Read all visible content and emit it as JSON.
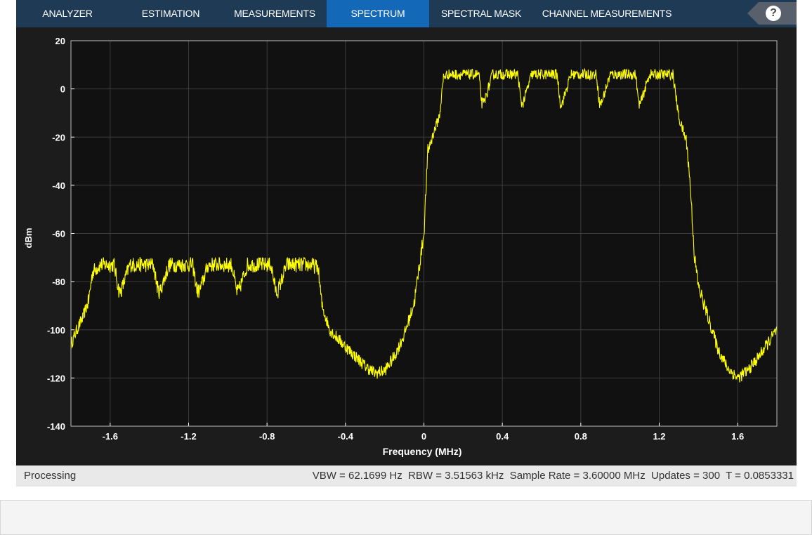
{
  "toolbar": {
    "tabs": [
      {
        "label": "ANALYZER",
        "active": false
      },
      {
        "label": "ESTIMATION",
        "active": false
      },
      {
        "label": "MEASUREMENTS",
        "active": false
      },
      {
        "label": "SPECTRUM",
        "active": true
      },
      {
        "label": "SPECTRAL MASK",
        "active": false
      },
      {
        "label": "CHANNEL MEASUREMENTS",
        "active": false
      }
    ],
    "help_label": "?"
  },
  "colors": {
    "toolbar_bg": "#1f3a54",
    "active_tab": "#1468b8",
    "plot_bg": "#111111",
    "trace": "#ffff00"
  },
  "status": {
    "left": "Processing",
    "right": "VBW = 62.1699 Hz  RBW = 3.51563 kHz  Sample Rate = 3.60000 MHz  Updates = 300  T = 0.0853331"
  },
  "chart_data": {
    "type": "line",
    "xlabel": "Frequency (MHz)",
    "ylabel": "dBm",
    "xlim": [
      -1.8,
      1.8
    ],
    "ylim": [
      -140,
      20
    ],
    "xticks": [
      -1.6,
      -1.2,
      -0.8,
      -0.4,
      0,
      0.4,
      0.8,
      1.2,
      1.6
    ],
    "yticks": [
      20,
      0,
      -20,
      -40,
      -60,
      -80,
      -100,
      -120,
      -140
    ],
    "grid": true,
    "series": [
      {
        "x": [
          -1.8,
          -1.77,
          -1.74,
          -1.71,
          -1.69,
          -1.65,
          -1.58,
          -1.555,
          -1.545,
          -1.5,
          -1.38,
          -1.355,
          -1.345,
          -1.3,
          -1.18,
          -1.155,
          -1.145,
          -1.1,
          -0.98,
          -0.955,
          -0.945,
          -0.9,
          -0.78,
          -0.755,
          -0.745,
          -0.7,
          -0.58,
          -0.54,
          -0.52,
          -0.48,
          -0.4,
          -0.3,
          -0.25,
          -0.2,
          -0.15,
          -0.1,
          -0.05,
          0,
          0.02,
          0.05,
          0.08,
          0.1,
          0.12,
          0.2,
          0.28,
          0.295,
          0.305,
          0.35,
          0.48,
          0.495,
          0.505,
          0.55,
          0.68,
          0.695,
          0.705,
          0.75,
          0.88,
          0.895,
          0.905,
          0.95,
          1.08,
          1.095,
          1.105,
          1.15,
          1.27,
          1.3,
          1.34,
          1.36,
          1.38,
          1.4,
          1.45,
          1.5,
          1.55,
          1.6,
          1.65,
          1.7,
          1.75,
          1.8
        ],
        "y": [
          -106,
          -100,
          -95,
          -88,
          -76,
          -73,
          -73,
          -84,
          -84,
          -73,
          -73,
          -84,
          -84,
          -73,
          -73,
          -84,
          -84,
          -73,
          -73,
          -84,
          -84,
          -73,
          -73,
          -84,
          -84,
          -73,
          -73,
          -74,
          -90,
          -100,
          -107,
          -115,
          -118,
          -117,
          -111,
          -102,
          -89,
          -60,
          -26,
          -18,
          -11,
          5,
          6,
          6,
          6,
          -6,
          -6,
          6,
          6,
          -6,
          -6,
          6,
          6,
          -6,
          -6,
          6,
          6,
          -6,
          -6,
          6,
          6,
          -6,
          -6,
          6,
          6,
          -12,
          -22,
          -42,
          -70,
          -82,
          -95,
          -108,
          -116,
          -120,
          -117,
          -112,
          -106,
          -100
        ]
      }
    ]
  }
}
